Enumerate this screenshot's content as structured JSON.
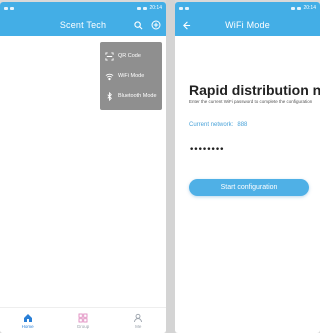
{
  "status": {
    "left_time": "20:14",
    "right_time": "20:14"
  },
  "left": {
    "title": "Scent Tech",
    "menu": [
      {
        "label": "QR Code",
        "icon": "qr-scan-icon"
      },
      {
        "label": "WiFi Mode",
        "icon": "wifi-icon"
      },
      {
        "label": "Bluetooth Mode",
        "icon": "bluetooth-icon"
      }
    ],
    "nav": [
      {
        "label": "Home",
        "icon": "home-icon",
        "active": true
      },
      {
        "label": "Group",
        "icon": "grid-icon",
        "active": false
      },
      {
        "label": "Me",
        "icon": "user-icon",
        "active": false
      }
    ]
  },
  "right": {
    "title": "WiFi Mode",
    "heading": "Rapid distribution netw",
    "hint": "Enter the current WiFi password to complete the configuration",
    "network_label": "Current network:",
    "network_value": "888",
    "password_value": "••••••••",
    "start_label": "Start configuration"
  },
  "colors": {
    "primary": "#43aee6",
    "menu_bg": "#8f8f8f",
    "button": "#4fb0e6"
  }
}
